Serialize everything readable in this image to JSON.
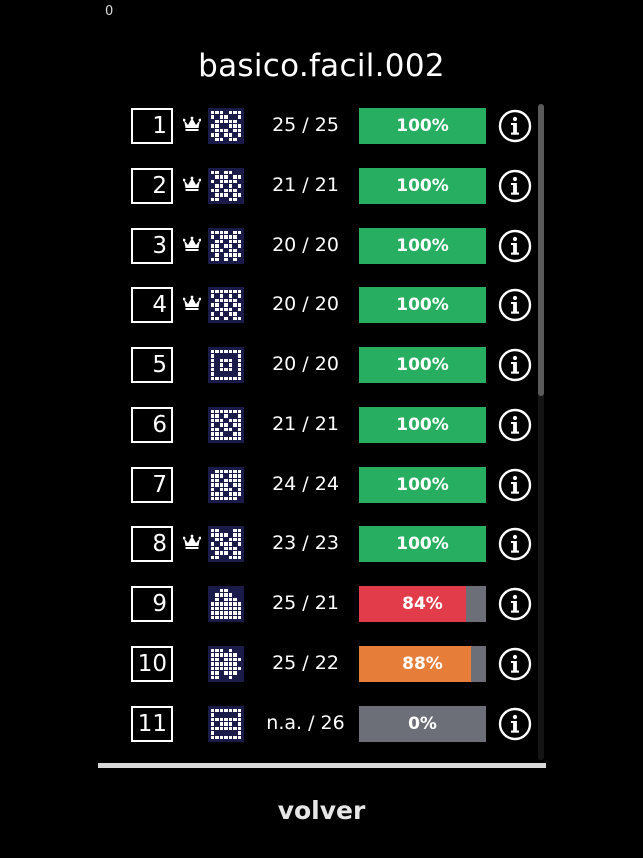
{
  "header": {
    "corner_counter": "0",
    "title": "basico.facil.002"
  },
  "colors": {
    "complete": "#27ae60",
    "low": "#e23c4b",
    "mid": "#e67e3a",
    "empty": "#6c6f78"
  },
  "levels": [
    {
      "number": "1",
      "crown": true,
      "score": "25 / 25",
      "progress": 1.0,
      "label": "100%",
      "color": "#27ae60",
      "icon": "nonogram-thumbnail",
      "pattern": [
        "1110111",
        "1011001",
        "0111110",
        "1100111",
        "0111011",
        "1101101",
        "0110110"
      ]
    },
    {
      "number": "2",
      "crown": true,
      "score": "21 / 21",
      "progress": 1.0,
      "label": "100%",
      "color": "#27ae60",
      "icon": "nonogram-thumbnail",
      "pattern": [
        "1101100",
        "0111011",
        "1011110",
        "0110101",
        "1101110",
        "0111011",
        "1100110"
      ]
    },
    {
      "number": "3",
      "crown": true,
      "score": "20 / 20",
      "progress": 1.0,
      "label": "100%",
      "color": "#27ae60",
      "icon": "nonogram-thumbnail",
      "pattern": [
        "1111011",
        "1011110",
        "0110111",
        "1101101",
        "1110110",
        "0101111",
        "1101010"
      ]
    },
    {
      "number": "4",
      "crown": true,
      "score": "20 / 20",
      "progress": 1.0,
      "label": "100%",
      "color": "#27ae60",
      "icon": "nonogram-thumbnail",
      "pattern": [
        "1111111",
        "1010101",
        "0111110",
        "1101011",
        "0111101",
        "1010110",
        "1101011"
      ]
    },
    {
      "number": "5",
      "crown": false,
      "score": "20 / 20",
      "progress": 1.0,
      "label": "100%",
      "color": "#27ae60",
      "icon": "nonogram-thumbnail",
      "pattern": [
        "1111111",
        "1000001",
        "1011101",
        "1010101",
        "1011101",
        "1000001",
        "1111111"
      ]
    },
    {
      "number": "6",
      "crown": false,
      "score": "21 / 21",
      "progress": 1.0,
      "label": "100%",
      "color": "#27ae60",
      "icon": "nonogram-thumbnail",
      "pattern": [
        "1111111",
        "1101001",
        "1110111",
        "1011011",
        "1101101",
        "1110011",
        "1111111"
      ]
    },
    {
      "number": "7",
      "crown": false,
      "score": "24 / 24",
      "progress": 1.0,
      "label": "100%",
      "color": "#27ae60",
      "icon": "nonogram-thumbnail",
      "pattern": [
        "0111111",
        "1110111",
        "1101111",
        "1111011",
        "1011101",
        "1110111",
        "1111110"
      ]
    },
    {
      "number": "8",
      "crown": true,
      "score": "23 / 23",
      "progress": 1.0,
      "label": "100%",
      "color": "#27ae60",
      "icon": "nonogram-thumbnail",
      "pattern": [
        "1100011",
        "1111011",
        "0110111",
        "1011101",
        "1101110",
        "0111011",
        "1100111"
      ]
    },
    {
      "number": "9",
      "crown": false,
      "score": "25 / 21",
      "progress": 0.84,
      "label": "84%",
      "color": "#e23c4b",
      "icon": "nonogram-thumbnail",
      "pattern": [
        "0011000",
        "0111100",
        "0101110",
        "1111111",
        "1111111",
        "1111111",
        "1111111"
      ]
    },
    {
      "number": "10",
      "crown": false,
      "score": "25 / 22",
      "progress": 0.88,
      "label": "88%",
      "color": "#e67e3a",
      "icon": "nonogram-thumbnail",
      "pattern": [
        "1110100",
        "1111110",
        "1101111",
        "1111110",
        "1111111",
        "1101110",
        "1100100"
      ]
    },
    {
      "number": "11",
      "crown": false,
      "score": "n.a. / 26",
      "progress": 0.0,
      "label": "0%",
      "color": "#6c6f78",
      "icon": "nonogram-thumbnail",
      "pattern": [
        "1111111",
        "1000001",
        "1111111",
        "1011101",
        "1111111",
        "1000001",
        "1111111"
      ]
    }
  ],
  "scrollbar": {
    "position": 0.0,
    "visible_fraction": 0.44
  },
  "footer": {
    "back_label": "volver"
  }
}
